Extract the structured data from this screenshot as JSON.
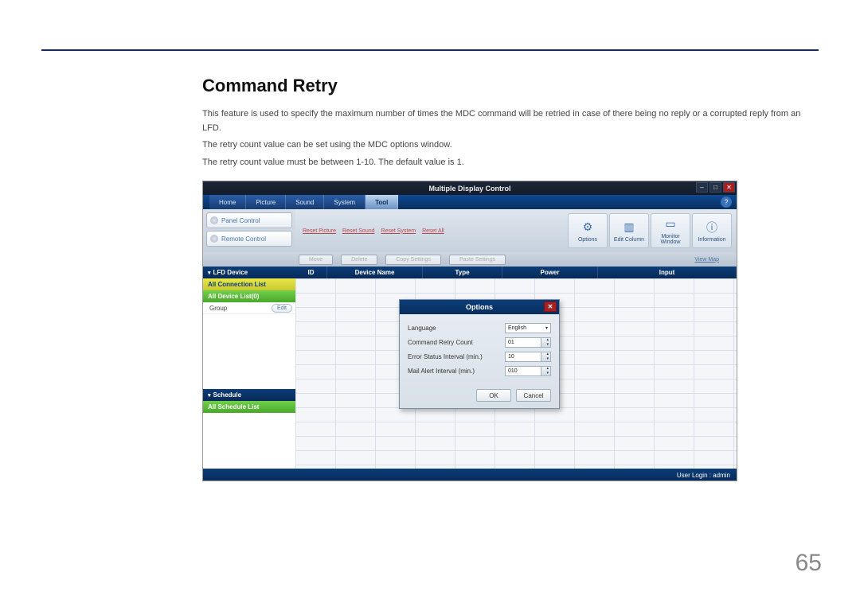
{
  "doc": {
    "heading": "Command Retry",
    "para1": "This feature is used to specify the maximum number of times the MDC command will be retried in case of there being no reply or a corrupted reply from an LFD.",
    "para2": "The retry count value can be set using the MDC options window.",
    "para3": "The retry count value must be between 1-10. The default value is 1.",
    "page_number": "65"
  },
  "app": {
    "title": "Multiple Display Control",
    "menu": [
      "Home",
      "Picture",
      "Sound",
      "System",
      "Tool"
    ],
    "active_menu_index": 4,
    "left_tools": [
      {
        "label": "Panel Control"
      },
      {
        "label": "Remote Control"
      }
    ],
    "reset_links": [
      "Reset Picture",
      "Reset Sound",
      "Reset System",
      "Reset All"
    ],
    "toolbar_icons": [
      {
        "label": "Options",
        "glyph": "⚙"
      },
      {
        "label": "Edit Column",
        "glyph": "▥"
      },
      {
        "label": "Monitor Window",
        "glyph": "▭"
      },
      {
        "label": "Information",
        "glyph": "ⓘ"
      }
    ],
    "subbar_buttons": [
      "Move",
      "Delete",
      "Copy Settings",
      "Paste Settings"
    ],
    "subbar_link": "View Map",
    "sidebar": {
      "section1": "LFD Device",
      "conn_list": "All Connection List",
      "device_list": "All Device List(0)",
      "group_label": "Group",
      "edit_label": "Edit",
      "section2": "Schedule",
      "schedule_list": "All Schedule List"
    },
    "grid_headers": [
      "ID",
      "Device Name",
      "Type",
      "Power",
      "Input"
    ],
    "options_dialog": {
      "title": "Options",
      "rows": [
        {
          "label": "Language",
          "value": "English",
          "type": "dropdown"
        },
        {
          "label": "Command Retry Count",
          "value": "01",
          "type": "spinner"
        },
        {
          "label": "Error Status Interval (min.)",
          "value": "10",
          "type": "spinner"
        },
        {
          "label": "Mail Alert Interval (min.)",
          "value": "010",
          "type": "spinner"
        }
      ],
      "ok": "OK",
      "cancel": "Cancel"
    },
    "status": "User Login : admin"
  }
}
